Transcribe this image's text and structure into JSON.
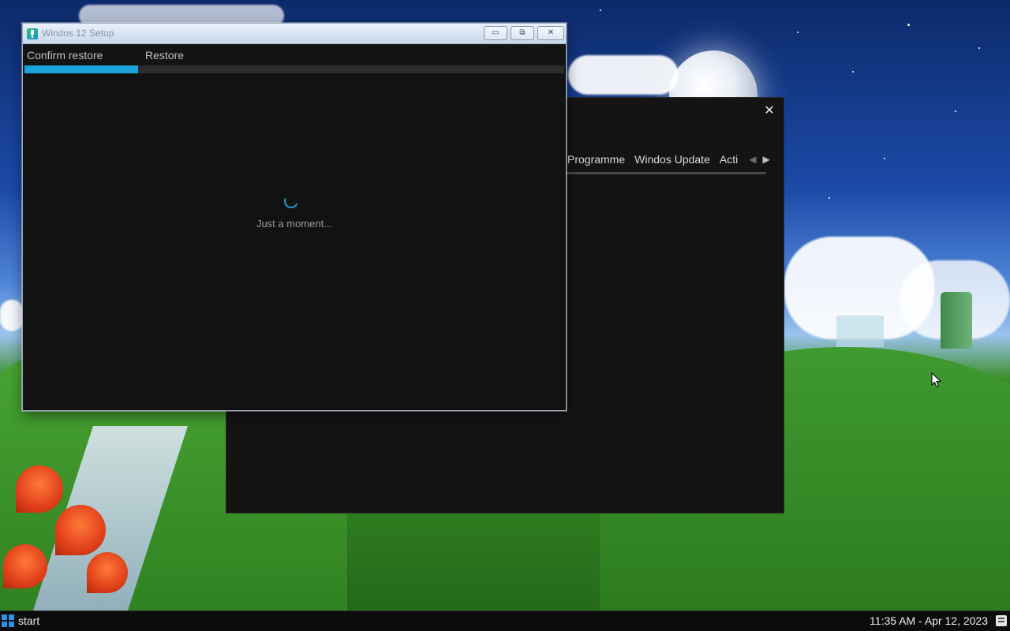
{
  "colors": {
    "accent": "#1aa3d8",
    "window_bg": "#121212",
    "taskbar_bg": "#0c0c0c"
  },
  "back_window": {
    "close_icon": "close-icon",
    "tabs": [
      "Programme",
      "Windos Update",
      "Acti"
    ],
    "arrows": {
      "left": "◀",
      "right": "▶"
    }
  },
  "setup_window": {
    "title": "Windos 12 Setup",
    "controls": {
      "minimize": "▭",
      "maximize": "⧉",
      "close": "✕"
    },
    "steps": [
      "Confirm restore",
      "Restore"
    ],
    "progress_fraction": 0.21,
    "status_text": "Just a moment..."
  },
  "taskbar": {
    "start_label": "start",
    "clock": "11:35 AM - Apr 12, 2023"
  }
}
